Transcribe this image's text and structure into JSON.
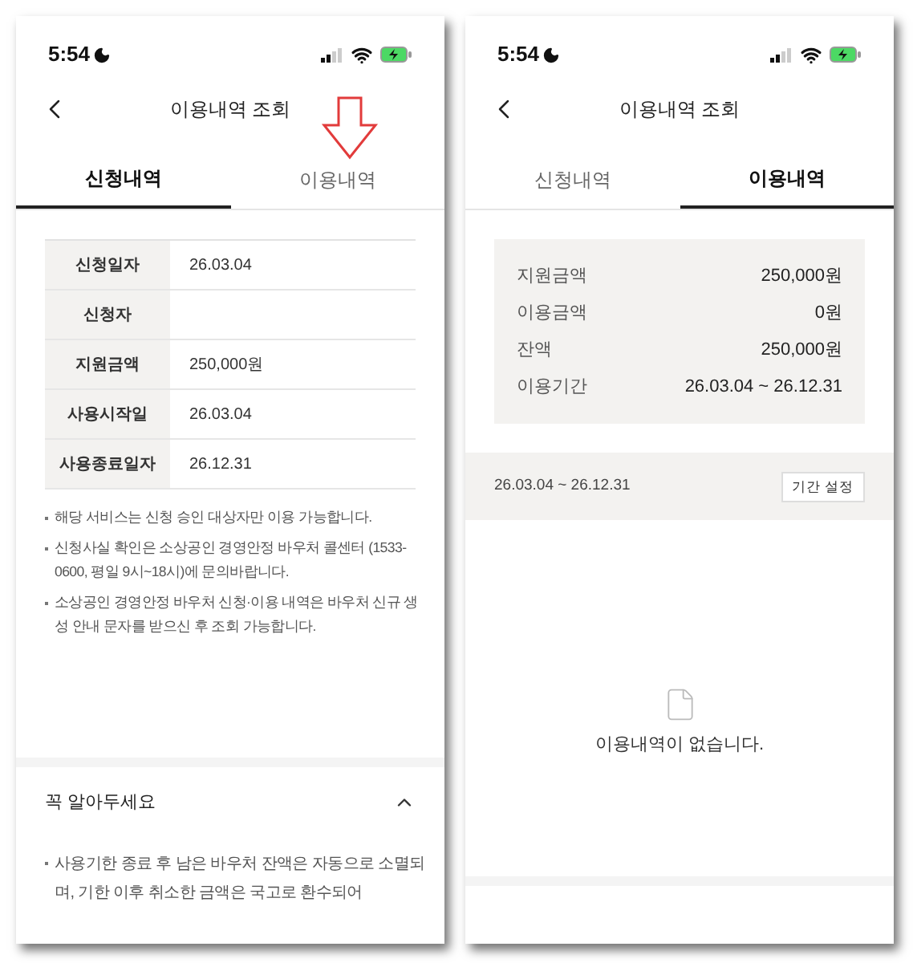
{
  "screens": [
    {
      "kind": "application",
      "time": "5:54",
      "title": "이용내역 조회",
      "annotation_arrow": true,
      "tabs": [
        {
          "label": "신청내역",
          "selected": true
        },
        {
          "label": "이용내역",
          "selected": false
        }
      ],
      "details": [
        {
          "label": "신청일자",
          "value": "26.03.04"
        },
        {
          "label": "신청자"
        },
        {
          "label": "지원금액",
          "value": "250,000원"
        },
        {
          "label": "사용시작일",
          "value": "26.03.04"
        },
        {
          "label": "사용종료일자",
          "value": "26.12.31"
        }
      ],
      "notes": [
        "해당 서비스는 신청 승인 대상자만 이용 가능합니다.",
        "신청사실 확인은 소상공인 경영안정 바우처 콜센터 (1533-0600, 평일 9시~18시)에 문의바랍니다.",
        "소상공인 경영안정 바우처 신청·이용 내역은 바우처 신규 생성 안내 문자를 받으신 후 조회 가능합니다."
      ],
      "notice": {
        "title": "꼭 알아두세요",
        "expanded": true,
        "text": "사용기한 종료 후 남은 바우처 잔액은 자동으로 소멸되며, 기한 이후 취소한 금액은 국고로 환수되어"
      }
    },
    {
      "kind": "usage",
      "time": "5:54",
      "title": "이용내역 조회",
      "annotation_arrow": false,
      "tabs": [
        {
          "label": "신청내역",
          "selected": false
        },
        {
          "label": "이용내역",
          "selected": true
        }
      ],
      "summary": [
        {
          "label": "지원금액",
          "value": "250,000원"
        },
        {
          "label": "이용금액",
          "value": "0원"
        },
        {
          "label": "잔액",
          "value": "250,000원"
        },
        {
          "label": "이용기간",
          "value": "26.03.04 ~ 26.12.31"
        }
      ],
      "period": "26.03.04 ~ 26.12.31",
      "period_button": "기간 설정",
      "empty_message": "이용내역이 없습니다."
    }
  ]
}
